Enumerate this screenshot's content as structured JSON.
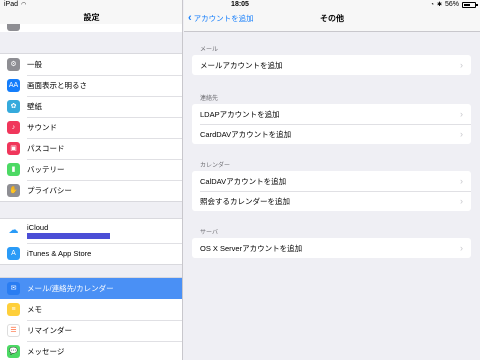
{
  "status": {
    "device": "iPad",
    "time": "18:05",
    "battery": "56%",
    "battery_level": 0.56
  },
  "sidebar": {
    "title": "設定",
    "group1": [
      {
        "label": "一般",
        "icon": "gear-icon",
        "color": "#8e8e93",
        "glyph": "⚙"
      },
      {
        "label": "画面表示と明るさ",
        "icon": "display-icon",
        "color": "#157efb",
        "glyph": "AA"
      },
      {
        "label": "壁紙",
        "icon": "wallpaper-icon",
        "color": "#35aadc",
        "glyph": "✿"
      },
      {
        "label": "サウンド",
        "icon": "sound-icon",
        "color": "#f0365b",
        "glyph": "♪"
      },
      {
        "label": "パスコード",
        "icon": "lock-icon",
        "color": "#f0365b",
        "glyph": "▣"
      },
      {
        "label": "バッテリー",
        "icon": "battery-icon",
        "color": "#4cd964",
        "glyph": "▮"
      },
      {
        "label": "プライバシー",
        "icon": "hand-icon",
        "color": "#8e8e93",
        "glyph": "✋"
      }
    ],
    "icloud": {
      "label": "iCloud",
      "icon": "cloud-icon",
      "color": "#ffffff"
    },
    "itunes": {
      "label": "iTunes & App Store",
      "icon": "app-store-icon",
      "color": "#2a9bf7",
      "glyph": "A"
    },
    "group3": [
      {
        "label": "メール/連絡先/カレンダー",
        "icon": "mail-icon",
        "color": "#2a7df2",
        "glyph": "✉",
        "selected": true
      },
      {
        "label": "メモ",
        "icon": "notes-icon",
        "color": "#fecf3b",
        "glyph": "≡"
      },
      {
        "label": "リマインダー",
        "icon": "reminders-icon",
        "color": "#ffffff",
        "glyph": "☰"
      },
      {
        "label": "メッセージ",
        "icon": "messages-icon",
        "color": "#4cd964",
        "glyph": "💬"
      }
    ]
  },
  "nav": {
    "back_label": "アカウントを追加",
    "title": "その他"
  },
  "sections": [
    {
      "title": "メール",
      "rows": [
        "メールアカウントを追加"
      ]
    },
    {
      "title": "連絡先",
      "rows": [
        "LDAPアカウントを追加",
        "CardDAVアカウントを追加"
      ]
    },
    {
      "title": "カレンダー",
      "rows": [
        "CalDAVアカウントを追加",
        "照会するカレンダーを追加"
      ]
    },
    {
      "title": "サーバ",
      "rows": [
        "OS X Serverアカウントを追加"
      ]
    }
  ]
}
